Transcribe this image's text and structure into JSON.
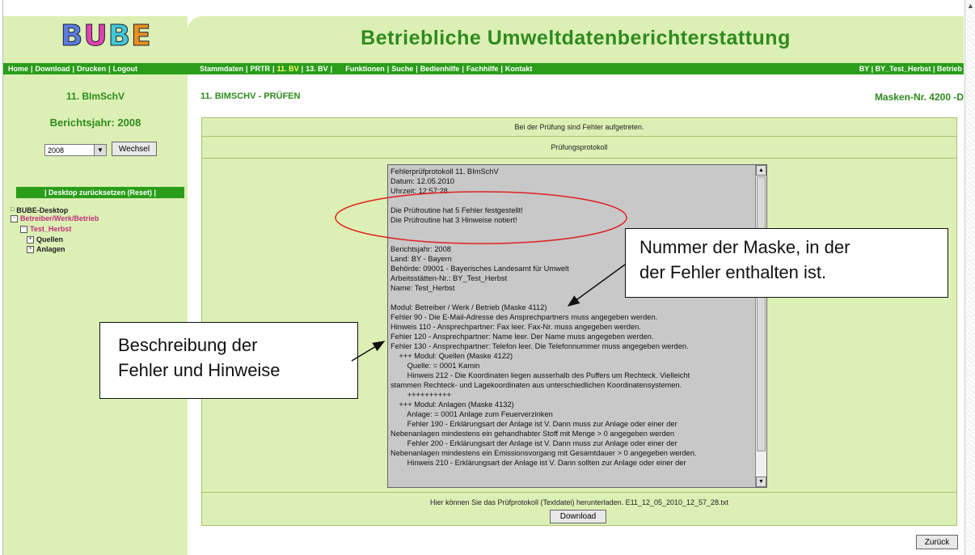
{
  "logo": {
    "text": "BUBE",
    "letters": [
      "B",
      "U",
      "B",
      "E"
    ],
    "colors": [
      "#5a7be0",
      "#e040b0",
      "#40c8d8",
      "#e89020"
    ]
  },
  "header": {
    "title": "Betriebliche Umweltdatenberichterstattung"
  },
  "nav": {
    "left": [
      "Home",
      "Download",
      "Drucken",
      "Logout"
    ],
    "mid": [
      "Stammdaten",
      "PRTR",
      "11. BV",
      "13. BV"
    ],
    "mid_active": "11. BV",
    "mid2": [
      "Funktionen",
      "Suche",
      "Bedienhilfe",
      "Fachhilfe",
      "Kontakt"
    ],
    "right": "BY | BY_Test_Herbst | Betrieb"
  },
  "sidebar": {
    "title": "11. BImSchV",
    "year_label": "Berichtsjahr: 2008",
    "year_value": "2008",
    "wechsel_label": "Wechsel",
    "reset_label": "| Desktop zurücksetzen (Reset) |",
    "tree": [
      {
        "label": "BUBE-Desktop",
        "marker": "□"
      },
      {
        "label": "Betreiber/Werk/Betrieb",
        "marker": "−"
      },
      {
        "label": "Test_Herbst",
        "marker": "−"
      },
      {
        "label": "Quellen",
        "marker": "+"
      },
      {
        "label": "Anlagen",
        "marker": "+"
      }
    ]
  },
  "page": {
    "heading": "11. BIMSCHV - PRÜFEN",
    "mask_no": "Masken-Nr. 4200 -D",
    "error_msg": "Bei der Prüfung sind Fehler aufgetreten.",
    "protocol_label": "Prüfungsprotokoll",
    "log_lines": [
      "Fehlerprüfprotokoll 11. BImSchV",
      "Datum: 12.05.2010",
      "Uhrzeit: 12:57:28",
      "",
      "Die Prüfroutine hat 5 Fehler festgestellt!",
      "Die Prüfroutine hat 3 Hinweise notiert!",
      "",
      "",
      "Berichtsjahr: 2008",
      "Land: BY - Bayern",
      "Behörde: 09001 - Bayerisches Landesamt für Umwelt",
      "Arbeitsstätten-Nr.: BY_Test_Herbst",
      "Name: Test_Herbst",
      "",
      "Modul: Betreiber / Werk / Betrieb (Maske 4112)",
      "Fehler 90 - Die E-Mail-Adresse des Ansprechpartners muss angegeben werden.",
      "Hinweis 110 - Ansprechpartner: Fax leer. Fax-Nr. muss angegeben werden.",
      "Fehler 120 - Ansprechpartner: Name leer. Der Name muss angegeben werden.",
      "Fehler 130 - Ansprechpartner: Telefon leer. Die Telefonnummer muss angegeben werden.",
      "    +++ Modul: Quellen (Maske 4122)",
      "        Quelle: = 0001 Kamin",
      "        Hinweis 212 - Die Koordinaten liegen ausserhalb des Puffers um Rechteck. Vielleicht",
      "stammen Rechteck- und Lagekoordinaten aus unterschiedlichen Koordinatensystemen.",
      "        ++++++++++",
      "    +++ Modul: Anlagen (Maske 4132)",
      "        Anlage: = 0001 Anlage zum Feuerverzinken",
      "        Fehler 190 - Erklärungsart der Anlage ist V. Dann muss zur Anlage oder einer der",
      "Nebenanlagen mindestens ein gehandhabter Stoff mit Menge > 0 angegeben werden",
      "        Fehler 200 - Erklärungsart der Anlage ist V. Dann muss zur Anlage oder einer der",
      "Nebenanlagen mindestens ein Emissionsvorgang mit Gesamtdauer > 0 angegeben werden.",
      "        Hinweis 210 - Erklärungsart der Anlage ist V. Dann sollten zur Anlage oder einer der"
    ],
    "download_text": "Hier können Sie das Prüfprotokoll (Textdatei) herunterladen. E11_12_05_2010_12_57_28.txt",
    "download_label": "Download",
    "back_label": "Zurück"
  },
  "callouts": {
    "mask": "Nummer der Maske, in der der Fehler enthalten ist.",
    "mask_lines": [
      "Nummer der Maske, in der",
      "der Fehler enthalten ist."
    ],
    "desc_lines": [
      "Beschreibung der",
      "Fehler und Hinweise"
    ]
  }
}
